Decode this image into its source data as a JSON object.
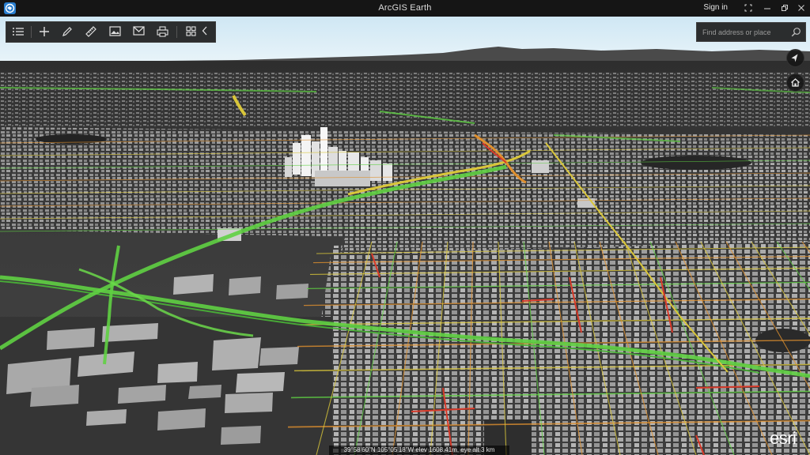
{
  "window": {
    "title": "ArcGIS Earth",
    "sign_in_label": "Sign in",
    "logo_icon": "globe-icon",
    "controls": [
      "fullscreen-icon",
      "minimize-icon",
      "restore-icon",
      "close-icon"
    ]
  },
  "toolbar": {
    "items": [
      {
        "name": "layers-list-icon"
      },
      {
        "name": "add-data-icon"
      },
      {
        "name": "draw-icon"
      },
      {
        "name": "measure-icon"
      },
      {
        "name": "image-icon"
      },
      {
        "name": "mail-icon"
      },
      {
        "name": "print-icon"
      },
      {
        "name": "grid-apps-icon"
      },
      {
        "name": "collapse-chevron-icon"
      }
    ]
  },
  "search": {
    "placeholder": "Find address or place",
    "value": ""
  },
  "nav": {
    "compass_icon": "compass-icon",
    "home_icon": "home-icon"
  },
  "status": {
    "coordinates": "39°58'60\"N  105°05'18\"W  elev 1608.41m,  eye alt 3 km"
  },
  "branding": {
    "logo_text": "esri"
  },
  "colors": {
    "traffic_green": "#5fd043",
    "traffic_yellow": "#d9c63a",
    "traffic_orange": "#e0902e",
    "traffic_red": "#d83a2a",
    "ground": "#3b3b3b",
    "sky": "#d7ecf6"
  }
}
